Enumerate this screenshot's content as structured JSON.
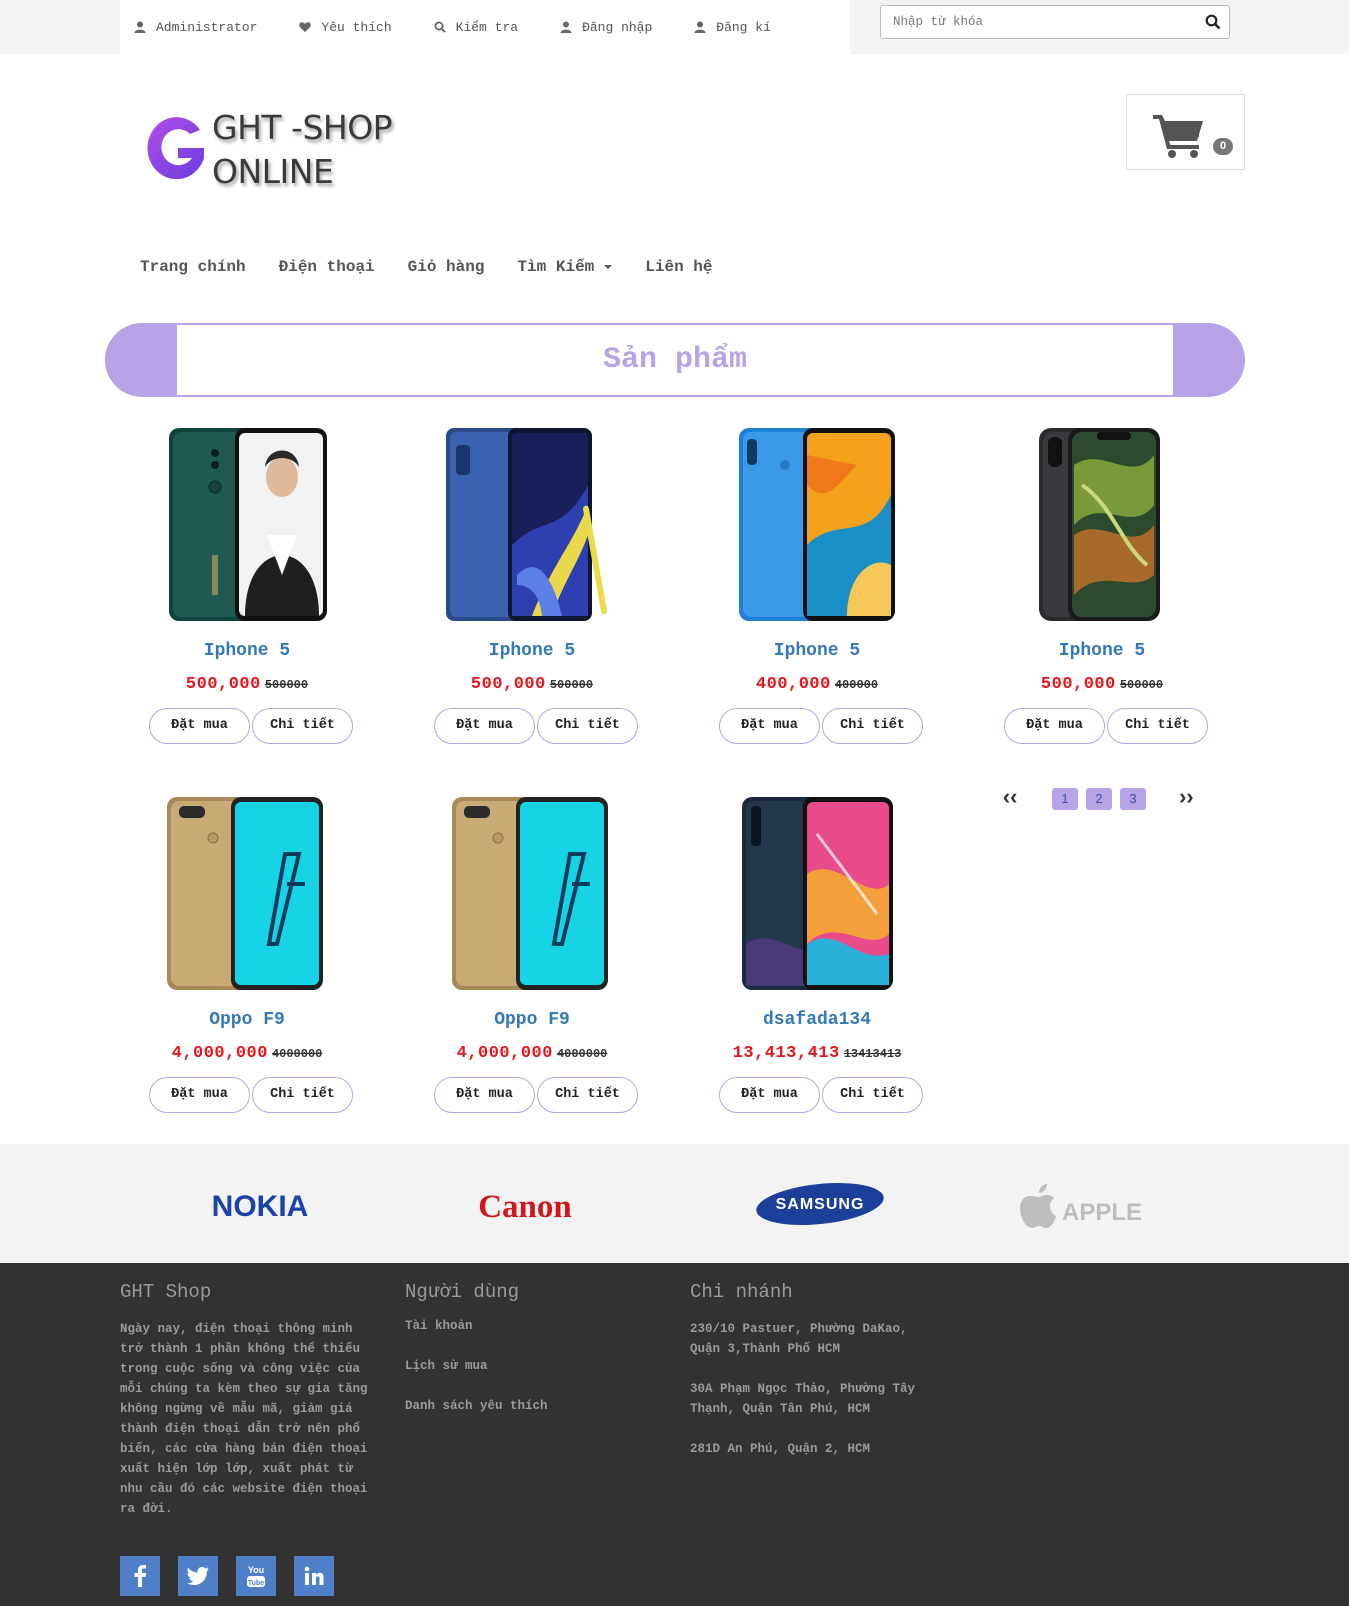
{
  "topnav": {
    "items": [
      {
        "label": "Administrator",
        "icon": "user-icon"
      },
      {
        "label": "Yêu thích",
        "icon": "heart-icon"
      },
      {
        "label": "Kiểm tra",
        "icon": "search-icon"
      },
      {
        "label": "Đăng nhập",
        "icon": "user-icon"
      },
      {
        "label": "Đăng kí",
        "icon": "user-icon"
      }
    ],
    "search_placeholder": "Nhập từ khóa"
  },
  "logo": {
    "letter": "G",
    "line1": "GHT -SHOP",
    "line2": "ONLINE"
  },
  "cart": {
    "count": "0"
  },
  "mainnav": {
    "items": [
      "Trang chính",
      "Điện thoại",
      "Giỏ hàng",
      "Tìm Kiếm",
      "Liên hệ"
    ]
  },
  "section": {
    "title": "Sản phẩm"
  },
  "products": [
    {
      "name": "Iphone 5",
      "price": "500,000",
      "old_price": "500000",
      "buy": "Đặt mua",
      "detail": "Chi tiết"
    },
    {
      "name": "Iphone 5",
      "price": "500,000",
      "old_price": "500000",
      "buy": "Đặt mua",
      "detail": "Chi tiết"
    },
    {
      "name": "Iphone 5",
      "price": "400,000",
      "old_price": "400000",
      "buy": "Đặt mua",
      "detail": "Chi tiết"
    },
    {
      "name": "Iphone 5",
      "price": "500,000",
      "old_price": "500000",
      "buy": "Đặt mua",
      "detail": "Chi tiết"
    },
    {
      "name": "Oppo F9",
      "price": "4,000,000",
      "old_price": "4000000",
      "buy": "Đặt mua",
      "detail": "Chi tiết"
    },
    {
      "name": "Oppo F9",
      "price": "4,000,000",
      "old_price": "4000000",
      "buy": "Đặt mua",
      "detail": "Chi tiết"
    },
    {
      "name": "dsafada134",
      "price": "13,413,413",
      "old_price": "13413413",
      "buy": "Đặt mua",
      "detail": "Chi tiết"
    }
  ],
  "pager": {
    "prev": "‹‹",
    "next": "››",
    "pages": [
      "1",
      "2",
      "3"
    ]
  },
  "brands": [
    "NOKIA",
    "Canon",
    "SAMSUNG",
    "APPLE"
  ],
  "footer": {
    "col1": {
      "title": "GHT Shop",
      "text": "Ngày nay, điện thoại thông minh trở thành 1 phần không thể thiếu trong cuộc sống và công việc của mỗi chúng ta kèm theo sự gia tăng không ngừng về mẫu mã, giảm giá thành điện thoại dẫn trở nên phổ biến, các cửa hàng bán điện thoại xuất hiện lớp lớp, xuất phát từ nhu cầu đó các website điện thoại ra đời."
    },
    "col2": {
      "title": "Người dùng",
      "links": [
        "Tài khoản",
        "Lịch sử mua",
        "Danh sách yêu thích"
      ]
    },
    "col3": {
      "title": "Chi nhánh",
      "addresses": [
        "230/10 Pastuer, Phường DaKao, Quận 3,Thành Phố HCM",
        "30A Phạm Ngọc Thảo, Phường Tây Thạnh, Quận Tân Phú, HCM",
        "281D An Phú, Quận 2, HCM"
      ]
    },
    "social": [
      "facebook-icon",
      "twitter-icon",
      "youtube-icon",
      "linkedin-icon"
    ]
  },
  "colors": {
    "accent": "#b8a3e6",
    "price": "#e8141b",
    "link": "#3478b8",
    "footer_bg": "#323232",
    "social_bg": "#4f7fc8"
  }
}
